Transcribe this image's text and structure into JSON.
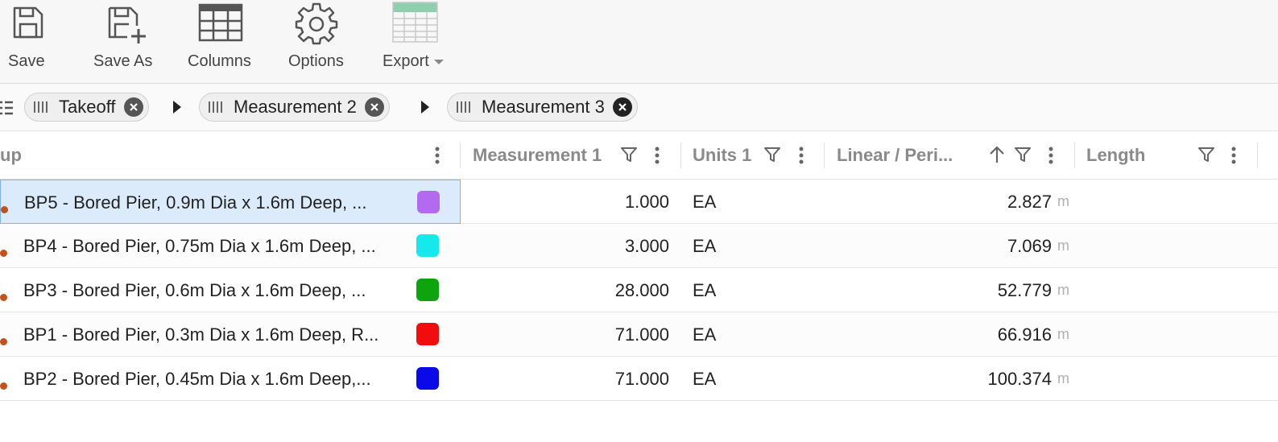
{
  "toolbar": {
    "save_label": "Save",
    "save_as_label": "Save As",
    "columns_label": "Columns",
    "options_label": "Options",
    "export_label": "Export"
  },
  "grouping": {
    "chips": [
      {
        "label": "Takeoff"
      },
      {
        "label": "Measurement 2"
      },
      {
        "label": "Measurement 3"
      }
    ]
  },
  "table": {
    "headers": {
      "group": "up",
      "measurement1": "Measurement 1",
      "units1": "Units 1",
      "linear": "Linear / Peri...",
      "length": "Length"
    },
    "rows": [
      {
        "name": "BP5 - Bored Pier, 0.9m Dia x 1.6m Deep, ...",
        "color": "#b36af0",
        "measurement1": "1.000",
        "units1": "EA",
        "linear": "2.827",
        "linear_unit": "m"
      },
      {
        "name": "BP4 - Bored Pier, 0.75m Dia x 1.6m Deep, ...",
        "color": "#16e9ee",
        "measurement1": "3.000",
        "units1": "EA",
        "linear": "7.069",
        "linear_unit": "m"
      },
      {
        "name": "BP3 - Bored Pier, 0.6m Dia x 1.6m Deep, ...",
        "color": "#0da40d",
        "measurement1": "28.000",
        "units1": "EA",
        "linear": "52.779",
        "linear_unit": "m"
      },
      {
        "name": "BP1 - Bored Pier, 0.3m Dia x 1.6m Deep, R...",
        "color": "#f10d0d",
        "measurement1": "71.000",
        "units1": "EA",
        "linear": "66.916",
        "linear_unit": "m"
      },
      {
        "name": "BP2 - Bored Pier, 0.45m Dia x 1.6m Deep,...",
        "color": "#0a0ae8",
        "measurement1": "71.000",
        "units1": "EA",
        "linear": "100.374",
        "linear_unit": "m"
      }
    ]
  }
}
